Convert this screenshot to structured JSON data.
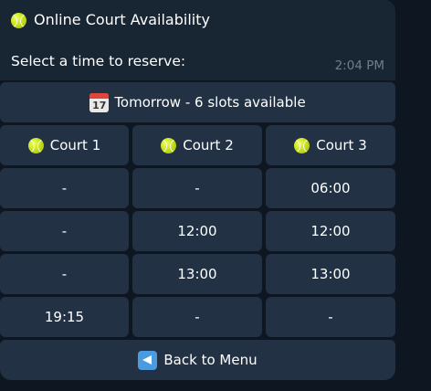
{
  "message": {
    "title": "Online Court Availability",
    "body": "Select a time to reserve:",
    "time": "2:04 PM"
  },
  "keyboard": {
    "date_button": "Tomorrow - 6 slots available",
    "courts": [
      "Court 1",
      "Court 2",
      "Court 3"
    ],
    "rows": [
      [
        "-",
        "-",
        "06:00"
      ],
      [
        "-",
        "12:00",
        "12:00"
      ],
      [
        "-",
        "13:00",
        "13:00"
      ],
      [
        "19:15",
        "-",
        "-"
      ]
    ],
    "back_button": "Back to Menu"
  },
  "icons": {
    "title": "tennis-ball-icon",
    "date": "calendar-icon",
    "court": "tennis-ball-icon",
    "back": "back-arrow-icon"
  },
  "colors": {
    "background": "#0e1621",
    "bubble": "#182533",
    "button": "#223244",
    "timestamp": "#6d7f8f"
  }
}
